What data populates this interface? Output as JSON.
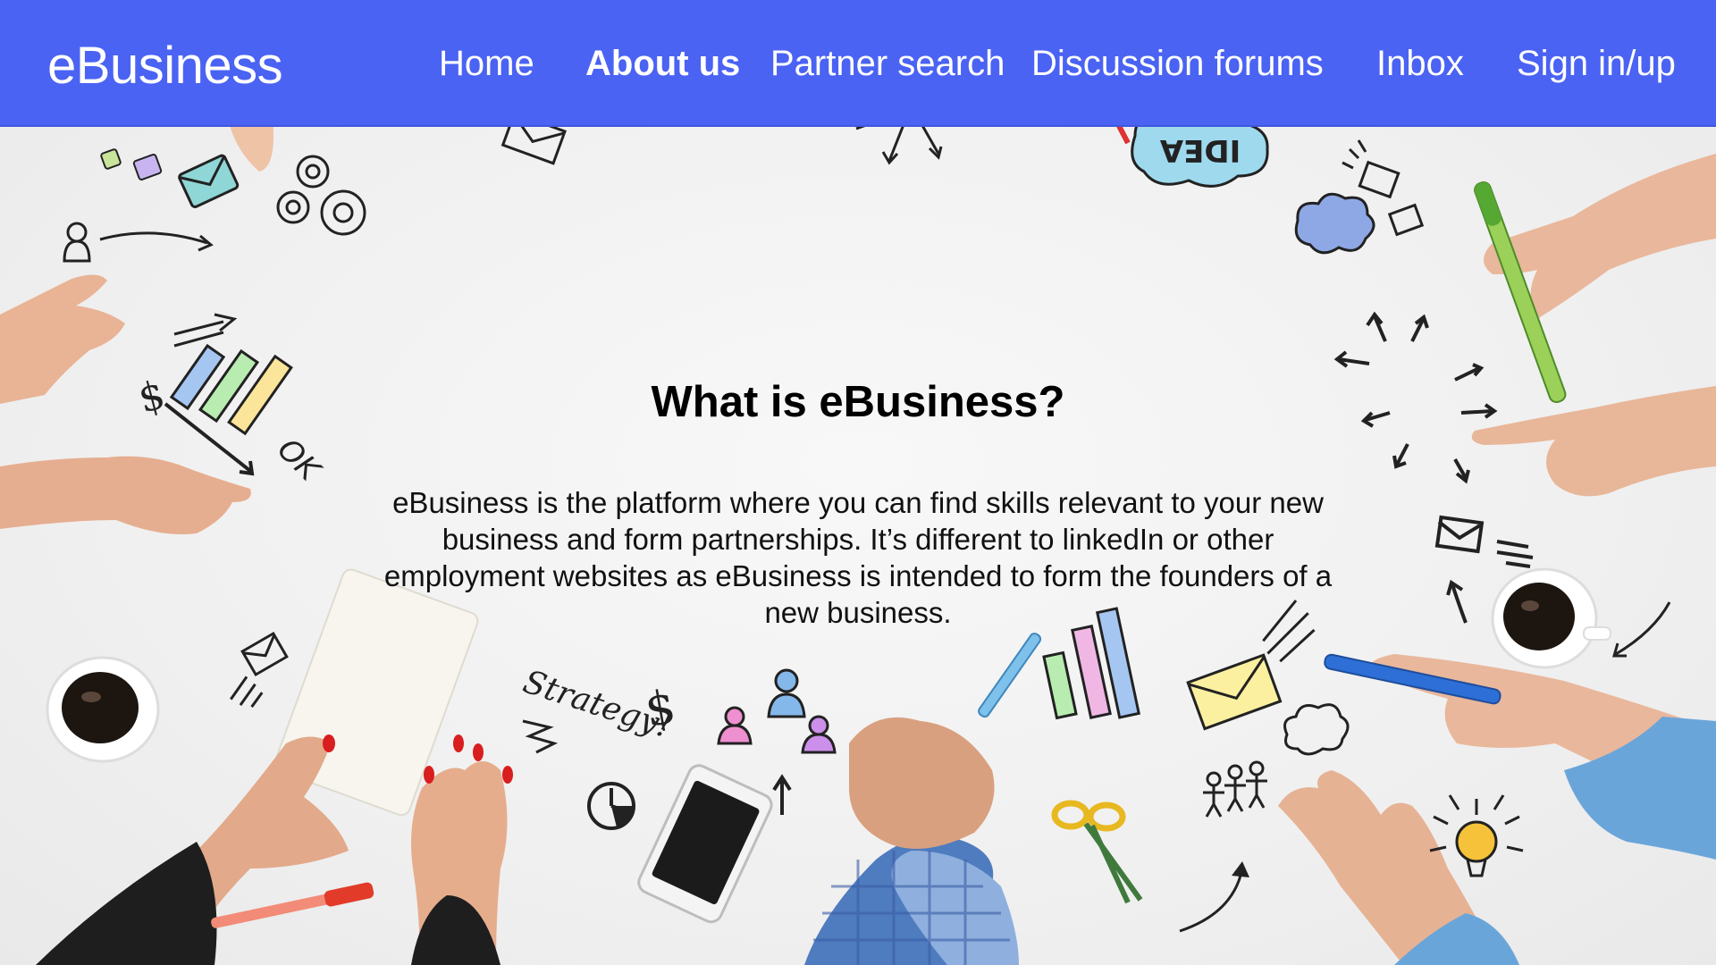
{
  "brand": "eBusiness",
  "nav": {
    "home": "Home",
    "about": "About us",
    "partner_search": "Partner search",
    "forums": "Discussion forums",
    "inbox": "Inbox",
    "sign": "Sign in/up"
  },
  "main": {
    "heading": "What is eBusiness?",
    "body": "eBusiness is the platform where you can find skills relevant to your new business and form partnerships. It’s different to linkedIn or other employment websites as eBusiness is intended to form the founders of a new business."
  },
  "doodles": {
    "strategy": "Strategy!",
    "ok": "OK",
    "idea": "IDEA",
    "dollar": "$"
  },
  "colors": {
    "navbar": "#4a63f3",
    "nav_text": "#ffffff",
    "background": "#f2f2f2"
  }
}
